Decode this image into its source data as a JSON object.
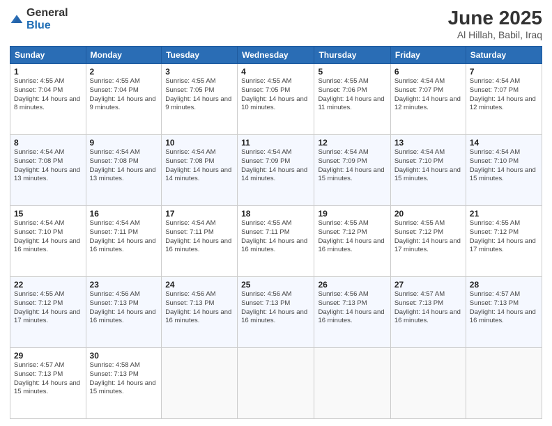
{
  "logo": {
    "general": "General",
    "blue": "Blue"
  },
  "title": "June 2025",
  "subtitle": "Al Hillah, Babil, Iraq",
  "days_of_week": [
    "Sunday",
    "Monday",
    "Tuesday",
    "Wednesday",
    "Thursday",
    "Friday",
    "Saturday"
  ],
  "weeks": [
    [
      {
        "day": 1,
        "sunrise": "4:55 AM",
        "sunset": "7:04 PM",
        "daylight": "14 hours and 8 minutes."
      },
      {
        "day": 2,
        "sunrise": "4:55 AM",
        "sunset": "7:04 PM",
        "daylight": "14 hours and 9 minutes."
      },
      {
        "day": 3,
        "sunrise": "4:55 AM",
        "sunset": "7:05 PM",
        "daylight": "14 hours and 9 minutes."
      },
      {
        "day": 4,
        "sunrise": "4:55 AM",
        "sunset": "7:05 PM",
        "daylight": "14 hours and 10 minutes."
      },
      {
        "day": 5,
        "sunrise": "4:55 AM",
        "sunset": "7:06 PM",
        "daylight": "14 hours and 11 minutes."
      },
      {
        "day": 6,
        "sunrise": "4:54 AM",
        "sunset": "7:07 PM",
        "daylight": "14 hours and 12 minutes."
      },
      {
        "day": 7,
        "sunrise": "4:54 AM",
        "sunset": "7:07 PM",
        "daylight": "14 hours and 12 minutes."
      }
    ],
    [
      {
        "day": 8,
        "sunrise": "4:54 AM",
        "sunset": "7:08 PM",
        "daylight": "14 hours and 13 minutes."
      },
      {
        "day": 9,
        "sunrise": "4:54 AM",
        "sunset": "7:08 PM",
        "daylight": "14 hours and 13 minutes."
      },
      {
        "day": 10,
        "sunrise": "4:54 AM",
        "sunset": "7:08 PM",
        "daylight": "14 hours and 14 minutes."
      },
      {
        "day": 11,
        "sunrise": "4:54 AM",
        "sunset": "7:09 PM",
        "daylight": "14 hours and 14 minutes."
      },
      {
        "day": 12,
        "sunrise": "4:54 AM",
        "sunset": "7:09 PM",
        "daylight": "14 hours and 15 minutes."
      },
      {
        "day": 13,
        "sunrise": "4:54 AM",
        "sunset": "7:10 PM",
        "daylight": "14 hours and 15 minutes."
      },
      {
        "day": 14,
        "sunrise": "4:54 AM",
        "sunset": "7:10 PM",
        "daylight": "14 hours and 15 minutes."
      }
    ],
    [
      {
        "day": 15,
        "sunrise": "4:54 AM",
        "sunset": "7:10 PM",
        "daylight": "14 hours and 16 minutes."
      },
      {
        "day": 16,
        "sunrise": "4:54 AM",
        "sunset": "7:11 PM",
        "daylight": "14 hours and 16 minutes."
      },
      {
        "day": 17,
        "sunrise": "4:54 AM",
        "sunset": "7:11 PM",
        "daylight": "14 hours and 16 minutes."
      },
      {
        "day": 18,
        "sunrise": "4:55 AM",
        "sunset": "7:11 PM",
        "daylight": "14 hours and 16 minutes."
      },
      {
        "day": 19,
        "sunrise": "4:55 AM",
        "sunset": "7:12 PM",
        "daylight": "14 hours and 16 minutes."
      },
      {
        "day": 20,
        "sunrise": "4:55 AM",
        "sunset": "7:12 PM",
        "daylight": "14 hours and 17 minutes."
      },
      {
        "day": 21,
        "sunrise": "4:55 AM",
        "sunset": "7:12 PM",
        "daylight": "14 hours and 17 minutes."
      }
    ],
    [
      {
        "day": 22,
        "sunrise": "4:55 AM",
        "sunset": "7:12 PM",
        "daylight": "14 hours and 17 minutes."
      },
      {
        "day": 23,
        "sunrise": "4:56 AM",
        "sunset": "7:13 PM",
        "daylight": "14 hours and 16 minutes."
      },
      {
        "day": 24,
        "sunrise": "4:56 AM",
        "sunset": "7:13 PM",
        "daylight": "14 hours and 16 minutes."
      },
      {
        "day": 25,
        "sunrise": "4:56 AM",
        "sunset": "7:13 PM",
        "daylight": "14 hours and 16 minutes."
      },
      {
        "day": 26,
        "sunrise": "4:56 AM",
        "sunset": "7:13 PM",
        "daylight": "14 hours and 16 minutes."
      },
      {
        "day": 27,
        "sunrise": "4:57 AM",
        "sunset": "7:13 PM",
        "daylight": "14 hours and 16 minutes."
      },
      {
        "day": 28,
        "sunrise": "4:57 AM",
        "sunset": "7:13 PM",
        "daylight": "14 hours and 16 minutes."
      }
    ],
    [
      {
        "day": 29,
        "sunrise": "4:57 AM",
        "sunset": "7:13 PM",
        "daylight": "14 hours and 15 minutes."
      },
      {
        "day": 30,
        "sunrise": "4:58 AM",
        "sunset": "7:13 PM",
        "daylight": "14 hours and 15 minutes."
      },
      null,
      null,
      null,
      null,
      null
    ]
  ],
  "labels": {
    "sunrise": "Sunrise:",
    "sunset": "Sunset:",
    "daylight": "Daylight:"
  }
}
